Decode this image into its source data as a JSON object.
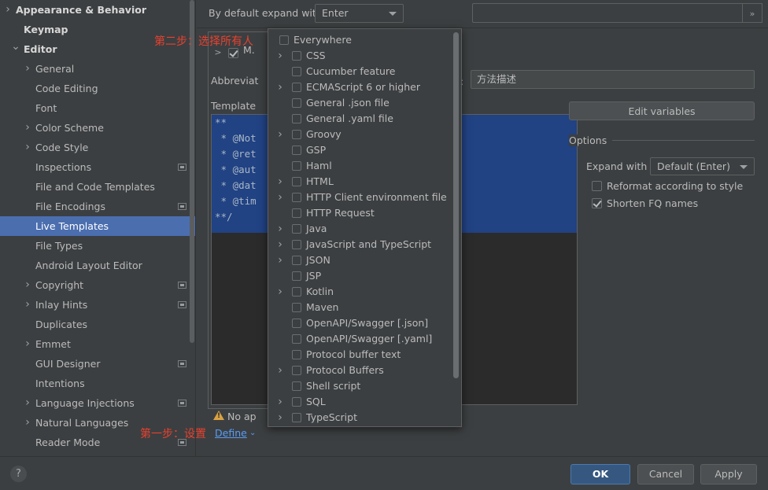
{
  "sidebar": {
    "items": [
      {
        "label": "Appearance & Behavior",
        "indent": 20,
        "chevron": ">",
        "bold": true,
        "selected": false,
        "modified": false
      },
      {
        "label": "Keymap",
        "indent": 30,
        "chevron": "",
        "bold": true,
        "selected": false,
        "modified": false
      },
      {
        "label": "Editor",
        "indent": 30,
        "chevron": "v",
        "bold": true,
        "selected": false,
        "modified": false
      },
      {
        "label": "General",
        "indent": 45,
        "chevron": ">",
        "bold": false,
        "selected": false,
        "modified": false
      },
      {
        "label": "Code Editing",
        "indent": 45,
        "chevron": "",
        "bold": false,
        "selected": false,
        "modified": false
      },
      {
        "label": "Font",
        "indent": 45,
        "chevron": "",
        "bold": false,
        "selected": false,
        "modified": false
      },
      {
        "label": "Color Scheme",
        "indent": 45,
        "chevron": ">",
        "bold": false,
        "selected": false,
        "modified": false
      },
      {
        "label": "Code Style",
        "indent": 45,
        "chevron": ">",
        "bold": false,
        "selected": false,
        "modified": false
      },
      {
        "label": "Inspections",
        "indent": 45,
        "chevron": "",
        "bold": false,
        "selected": false,
        "modified": true
      },
      {
        "label": "File and Code Templates",
        "indent": 45,
        "chevron": "",
        "bold": false,
        "selected": false,
        "modified": false
      },
      {
        "label": "File Encodings",
        "indent": 45,
        "chevron": "",
        "bold": false,
        "selected": false,
        "modified": true
      },
      {
        "label": "Live Templates",
        "indent": 45,
        "chevron": "",
        "bold": false,
        "selected": true,
        "modified": false
      },
      {
        "label": "File Types",
        "indent": 45,
        "chevron": "",
        "bold": false,
        "selected": false,
        "modified": false
      },
      {
        "label": "Android Layout Editor",
        "indent": 45,
        "chevron": "",
        "bold": false,
        "selected": false,
        "modified": false
      },
      {
        "label": "Copyright",
        "indent": 45,
        "chevron": ">",
        "bold": false,
        "selected": false,
        "modified": true
      },
      {
        "label": "Inlay Hints",
        "indent": 45,
        "chevron": ">",
        "bold": false,
        "selected": false,
        "modified": true
      },
      {
        "label": "Duplicates",
        "indent": 45,
        "chevron": "",
        "bold": false,
        "selected": false,
        "modified": false
      },
      {
        "label": "Emmet",
        "indent": 45,
        "chevron": ">",
        "bold": false,
        "selected": false,
        "modified": false
      },
      {
        "label": "GUI Designer",
        "indent": 45,
        "chevron": "",
        "bold": false,
        "selected": false,
        "modified": true
      },
      {
        "label": "Intentions",
        "indent": 45,
        "chevron": "",
        "bold": false,
        "selected": false,
        "modified": false
      },
      {
        "label": "Language Injections",
        "indent": 45,
        "chevron": ">",
        "bold": false,
        "selected": false,
        "modified": true
      },
      {
        "label": "Natural Languages",
        "indent": 45,
        "chevron": ">",
        "bold": false,
        "selected": false,
        "modified": false
      },
      {
        "label": "Reader Mode",
        "indent": 45,
        "chevron": "",
        "bold": false,
        "selected": false,
        "modified": true
      }
    ]
  },
  "main": {
    "expand_with_label": "By default expand with",
    "expand_with_value": "Enter",
    "abbreviation_label": "Abbreviat",
    "template_label": "Template",
    "description_value": "方法描述",
    "edit_variables_label": "Edit variables",
    "expander_label": "»",
    "no_applicable_label": "No ap",
    "define_link": "Define",
    "define_arrow": "⌄",
    "hidden_row_label": "M.",
    "code_lines": [
      "**",
      " * @Not",
      " * @ret",
      " * @aut",
      " * @dat",
      " * @tim",
      "**/"
    ]
  },
  "options": {
    "title": "Options",
    "expand_with_label": "Expand with",
    "expand_with_value": "Default (Enter)",
    "reformat_label": "Reformat according to style",
    "reformat_checked": false,
    "shorten_label": "Shorten FQ names",
    "shorten_checked": true
  },
  "popup": {
    "items": [
      {
        "label": "Everywhere",
        "level": 0,
        "chevron": "",
        "checked": false
      },
      {
        "label": "CSS",
        "level": 1,
        "chevron": ">",
        "checked": false
      },
      {
        "label": "Cucumber feature",
        "level": 1,
        "chevron": "",
        "checked": false
      },
      {
        "label": "ECMAScript 6 or higher",
        "level": 1,
        "chevron": ">",
        "checked": false
      },
      {
        "label": "General .json file",
        "level": 1,
        "chevron": "",
        "checked": false
      },
      {
        "label": "General .yaml file",
        "level": 1,
        "chevron": "",
        "checked": false
      },
      {
        "label": "Groovy",
        "level": 1,
        "chevron": ">",
        "checked": false
      },
      {
        "label": "GSP",
        "level": 1,
        "chevron": "",
        "checked": false
      },
      {
        "label": "Haml",
        "level": 1,
        "chevron": "",
        "checked": false
      },
      {
        "label": "HTML",
        "level": 1,
        "chevron": ">",
        "checked": false
      },
      {
        "label": "HTTP Client environment file",
        "level": 1,
        "chevron": ">",
        "checked": false
      },
      {
        "label": "HTTP Request",
        "level": 1,
        "chevron": "",
        "checked": false
      },
      {
        "label": "Java",
        "level": 1,
        "chevron": ">",
        "checked": false
      },
      {
        "label": "JavaScript and TypeScript",
        "level": 1,
        "chevron": ">",
        "checked": false
      },
      {
        "label": "JSON",
        "level": 1,
        "chevron": ">",
        "checked": false
      },
      {
        "label": "JSP",
        "level": 1,
        "chevron": "",
        "checked": false
      },
      {
        "label": "Kotlin",
        "level": 1,
        "chevron": ">",
        "checked": false
      },
      {
        "label": "Maven",
        "level": 1,
        "chevron": "",
        "checked": false
      },
      {
        "label": "OpenAPI/Swagger [.json]",
        "level": 1,
        "chevron": "",
        "checked": false
      },
      {
        "label": "OpenAPI/Swagger [.yaml]",
        "level": 1,
        "chevron": "",
        "checked": false
      },
      {
        "label": "Protocol buffer text",
        "level": 1,
        "chevron": "",
        "checked": false
      },
      {
        "label": "Protocol Buffers",
        "level": 1,
        "chevron": ">",
        "checked": false
      },
      {
        "label": "Shell script",
        "level": 1,
        "chevron": "",
        "checked": false
      },
      {
        "label": "SQL",
        "level": 1,
        "chevron": ">",
        "checked": false
      },
      {
        "label": "TypeScript",
        "level": 1,
        "chevron": ">",
        "checked": false
      }
    ]
  },
  "annotations": {
    "step2": "第二步：选择所有人",
    "step1": "第一步：设置"
  },
  "footer": {
    "help_label": "?",
    "ok_label": "OK",
    "cancel_label": "Cancel",
    "apply_label": "Apply"
  },
  "colors": {
    "accent": "#365880",
    "selection": "#4b6eaf",
    "annotation": "#e8412f",
    "link": "#589df6",
    "background": "#3c3f41",
    "editor_bg": "#2b2b2b",
    "editor_selection": "#214283"
  }
}
